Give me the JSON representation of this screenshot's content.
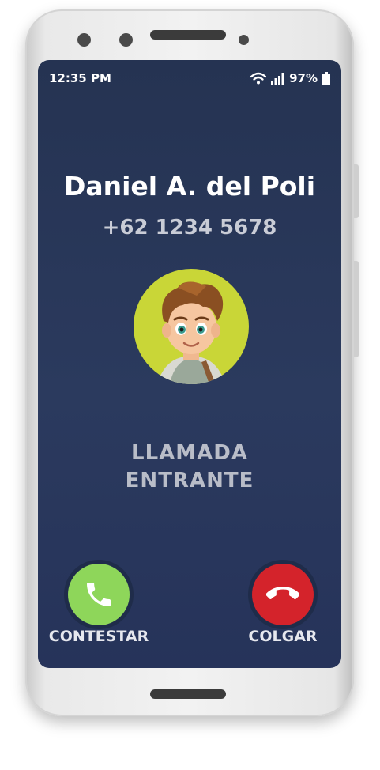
{
  "status_bar": {
    "time": "12:35 PM",
    "battery": "97%",
    "icons": [
      "wifi-icon",
      "signal-icon",
      "battery-icon"
    ]
  },
  "caller": {
    "name": "Daniel A. del Poli",
    "number": "+62 1234 5678"
  },
  "call_status": {
    "line1": "LLAMADA",
    "line2": "ENTRANTE"
  },
  "actions": {
    "answer_label": "CONTESTAR",
    "decline_label": "COLGAR"
  },
  "colors": {
    "screen_bg": "#253352",
    "answer": "#8ed65a",
    "decline": "#d4232b",
    "avatar_bg": "#c9d637"
  }
}
